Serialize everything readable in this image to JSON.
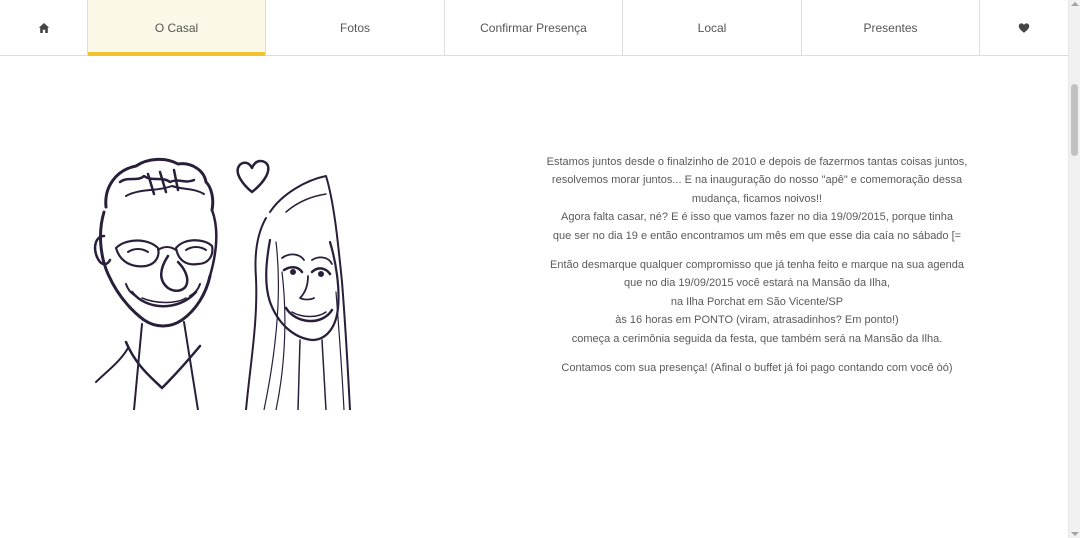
{
  "nav": {
    "home_icon": "home-icon",
    "items": [
      {
        "label": "O Casal",
        "active": true
      },
      {
        "label": "Fotos"
      },
      {
        "label": "Confirmar Presença"
      },
      {
        "label": "Local"
      },
      {
        "label": "Presentes"
      }
    ],
    "heart_icon": "heart-icon",
    "accent_color": "#f2c12e",
    "active_bg": "#fcf8e8"
  },
  "illustration": {
    "description_icon": "couple-caricature-illustration"
  },
  "story": {
    "paragraph1": [
      "Estamos juntos desde o finalzinho de 2010 e depois de fazermos tantas coisas juntos,",
      "resolvemos morar juntos... E na inauguração do nosso \"apê\" e comemoração dessa",
      "mudança, ficamos noivos!!",
      "Agora falta casar, né? E é isso que vamos fazer no dia 19/09/2015, porque tinha",
      "que ser no dia 19 e então encontramos um mês em que esse dia caía no sábado [="
    ],
    "paragraph2": [
      "Então desmarque qualquer compromisso que já tenha feito e marque na sua agenda",
      "que no dia 19/09/2015 você estará na Mansão da Ilha,",
      "na Ilha Porchat em São Vicente/SP",
      "às 16 horas em PONTO (viram, atrasadinhos? Em ponto!)",
      "começa a cerimônia seguida da festa, que também será na Mansão da Ilha."
    ],
    "paragraph3": "Contamos com sua presença! (Afinal o buffet já foi pago contando com você òó)"
  }
}
